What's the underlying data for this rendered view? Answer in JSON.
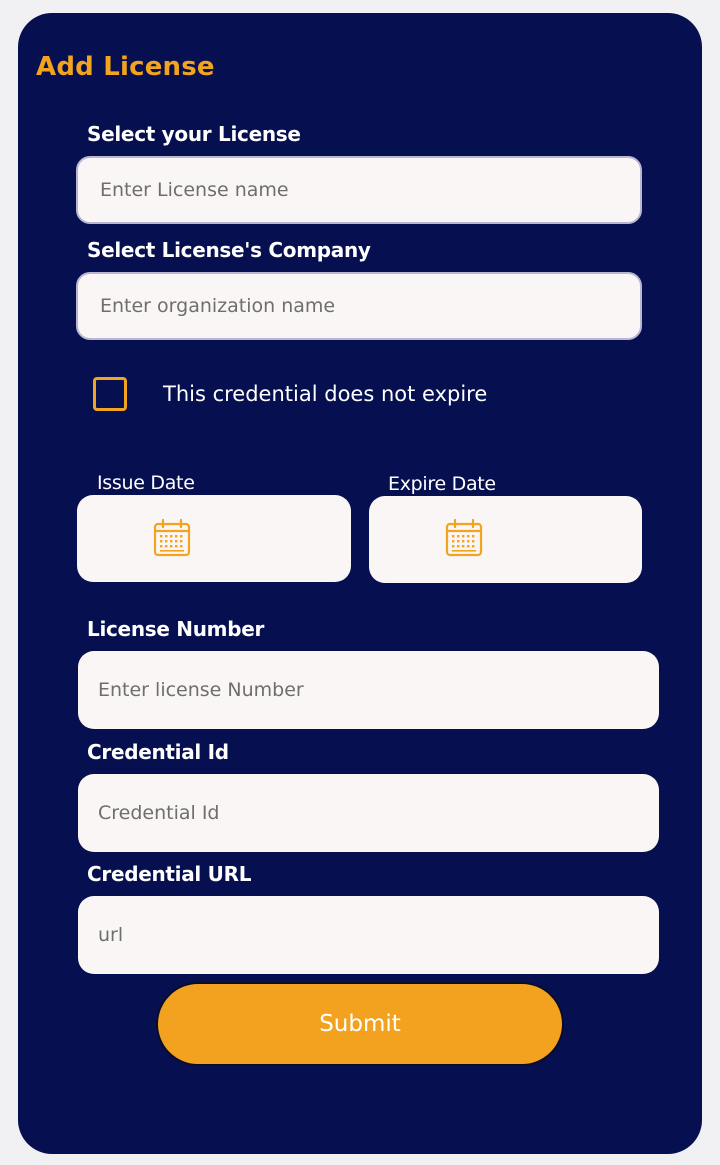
{
  "page": {
    "title": "Add License"
  },
  "license": {
    "label": "Select your License",
    "placeholder": "Enter License name"
  },
  "company": {
    "label": "Select License's Company",
    "placeholder": "Enter organization name"
  },
  "no_expire": {
    "label": "This credential does not expire",
    "checked": false
  },
  "issue_date": {
    "label": "Issue Date",
    "icon": "calendar-icon"
  },
  "expire_date": {
    "label": "Expire Date",
    "icon": "calendar-icon"
  },
  "license_number": {
    "label": "License Number",
    "placeholder": "Enter license Number"
  },
  "credential_id": {
    "label": "Credential Id",
    "placeholder": "Credential Id"
  },
  "credential_url": {
    "label": "Credential URL",
    "placeholder": "url"
  },
  "submit": {
    "label": "Submit"
  },
  "colors": {
    "card_bg": "#061050",
    "accent": "#f2a41f",
    "field_bg": "#faf6f6",
    "page_bg": "#f1f1f3"
  }
}
